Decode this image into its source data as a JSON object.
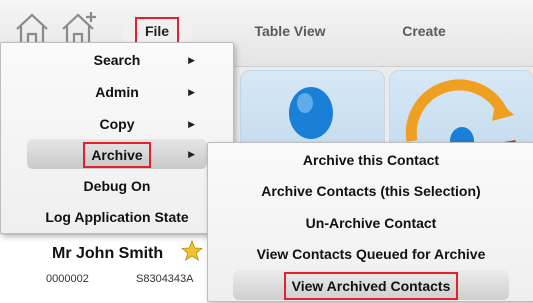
{
  "toolbar": {
    "home_icon": "home-icon",
    "add_home_icon": "home-add-icon",
    "tabs": [
      {
        "label": "File"
      },
      {
        "label": "Table View"
      },
      {
        "label": "Create"
      }
    ]
  },
  "file_menu": {
    "items": [
      {
        "label": "Search",
        "has_submenu": true
      },
      {
        "label": "Admin",
        "has_submenu": true
      },
      {
        "label": "Copy",
        "has_submenu": true
      },
      {
        "label": "Archive",
        "has_submenu": true
      },
      {
        "label": "Debug On",
        "has_submenu": false
      },
      {
        "label": "Log Application State",
        "has_submenu": false
      }
    ],
    "arrow_glyph": "▶"
  },
  "archive_submenu": {
    "items": [
      {
        "label": "Archive this Contact"
      },
      {
        "label": "Archive Contacts (this Selection)"
      },
      {
        "label": "Un-Archive Contact"
      },
      {
        "label": "View Contacts Queued for Archive"
      },
      {
        "label": "View Archived Contacts"
      }
    ]
  },
  "contact": {
    "name": "Mr John Smith",
    "id": "0000002",
    "ref": "S8304343A"
  },
  "colors": {
    "highlight": "#e3202d",
    "star": "#f2c230",
    "person_blue": "#1a7fd6"
  }
}
